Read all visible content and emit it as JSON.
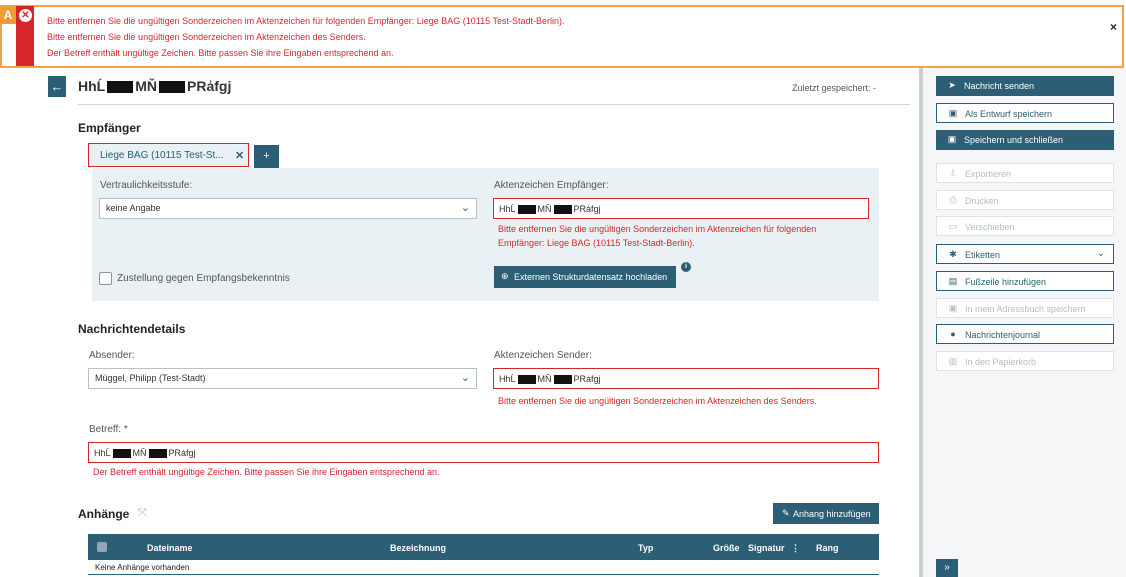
{
  "banner": {
    "marker": "A",
    "lines": [
      "Bitte entfernen Sie die ungültigen Sonderzeichen im Aktenzeichen für folgenden Empfänger: Liege BAG (10115 Test-Stadt-Berlin).",
      "Bitte entfernen Sie die ungültigen Sonderzeichen im Aktenzeichen des Senders.",
      "Der Betreff enthält ungültige Zeichen. Bitte passen Sie ihre Eingaben entsprechend an."
    ],
    "close": "×"
  },
  "header": {
    "title_a": "HhĹ",
    "title_b": "MŇ",
    "title_c": "PRẚfgj",
    "saved": "Zuletzt gespeichert: -"
  },
  "recipients": {
    "section": "Empfänger",
    "chip": "Liege BAG (10115 Test-St...",
    "add": "+",
    "confidentiality_label": "Vertraulichkeitsstufe:",
    "confidentiality_value": "keine Angabe",
    "ref_label": "Aktenzeichen Empfänger:",
    "ref_value_a": "HhĹ",
    "ref_value_b": "MŇ",
    "ref_value_c": "PRẚfgj",
    "ref_error_1": "Bitte entfernen Sie die ungültigen Sonderzeichen im Aktenzeichen für folgenden",
    "ref_error_2": "Empfänger: Liege BAG (10115 Test-Stadt-Berlin).",
    "delivery_label": "Zustellung gegen Empfangsbekenntnis",
    "upload_button": "Externen Strukturdatensatz hochladen"
  },
  "details": {
    "section": "Nachrichtendetails",
    "sender_label": "Absender:",
    "sender_value": "Müggel, Philipp (Test-Stadt)",
    "sender_ref_label": "Aktenzeichen Sender:",
    "sender_ref_a": "HhĹ",
    "sender_ref_b": "MŇ",
    "sender_ref_c": "PRẚfgj",
    "sender_ref_error": "Bitte entfernen Sie die ungültigen Sonderzeichen im Aktenzeichen des Senders.",
    "subject_label": "Betreff: *",
    "subject_a": "HhĹ",
    "subject_b": "MŇ",
    "subject_c": "PRẚfgj",
    "subject_error": "Der Betreff enthält ungültige Zeichen. Bitte passen Sie ihre Eingaben entsprechend an."
  },
  "attachments": {
    "section": "Anhänge",
    "add_button": "Anhang hinzufügen",
    "columns": [
      "Dateiname",
      "Bezeichnung",
      "Typ",
      "Größe",
      "Signatur",
      "Rang"
    ],
    "empty": "Keine Anhänge vorhanden"
  },
  "sidebar": {
    "send": "Nachricht senden",
    "draft": "Als Entwurf speichern",
    "save_close": "Speichern und schließen",
    "export": "Exportieren",
    "print": "Drucken",
    "move": "Verschieben",
    "labels": "Etiketten",
    "footer": "Fußzeile hinzufügen",
    "addressbook": "In mein Adressbuch speichern",
    "journal": "Nachrichtenjournal",
    "trash": "In den Papierkorb",
    "expand": "»"
  },
  "colors": {
    "primary": "#2c5f75",
    "error": "#d7262b",
    "highlight": "#f39c35"
  }
}
